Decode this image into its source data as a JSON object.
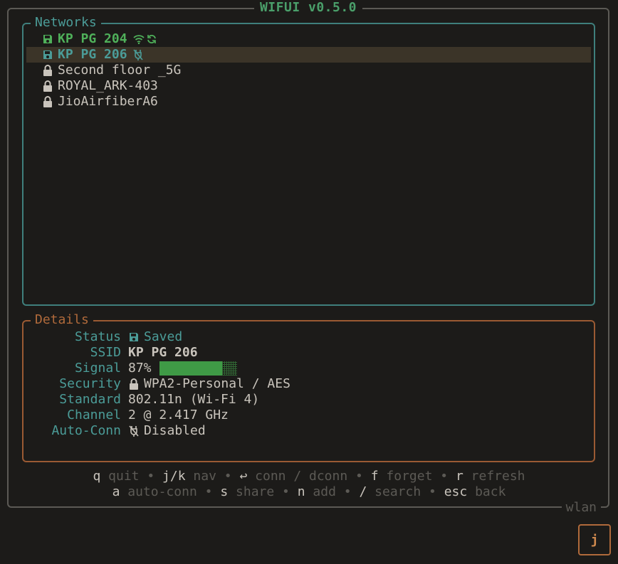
{
  "app": {
    "title": "WIFUI v0.5.0",
    "interface": "wlan"
  },
  "networks_panel": {
    "title": "Networks",
    "items": [
      {
        "name": "KP PG 204",
        "state": "connected",
        "icon": "save-icon",
        "trailing": [
          "wifi-icon",
          "refresh-icon"
        ]
      },
      {
        "name": "KP PG 206",
        "state": "saved",
        "icon": "save-icon",
        "trailing": [
          "autoconnect-off-icon"
        ],
        "selected": true
      },
      {
        "name": "Second floor _5G",
        "state": "available",
        "icon": "lock-icon",
        "trailing": []
      },
      {
        "name": "ROYAL_ARK-403",
        "state": "available",
        "icon": "lock-icon",
        "trailing": []
      },
      {
        "name": "JioAirfiberA6",
        "state": "available",
        "icon": "lock-icon",
        "trailing": []
      }
    ]
  },
  "details_panel": {
    "title": "Details",
    "status_label": "Status",
    "status_value": "Saved",
    "ssid_label": "SSID",
    "ssid_value": "KP PG 206",
    "signal_label": "Signal",
    "signal_value": "87%",
    "signal_fraction": 0.87,
    "security_label": "Security",
    "security_value": "WPA2-Personal / AES",
    "standard_label": "Standard",
    "standard_value": "802.11n (Wi-Fi 4)",
    "channel_label": "Channel",
    "channel_value": "2 @ 2.417 GHz",
    "autoconn_label": "Auto-Conn",
    "autoconn_value": "Disabled"
  },
  "help": {
    "line1": [
      {
        "key": "q",
        "desc": "quit"
      },
      {
        "key": "j/k",
        "desc": "nav"
      },
      {
        "key": "↩",
        "desc": "conn / dconn"
      },
      {
        "key": "f",
        "desc": "forget"
      },
      {
        "key": "r",
        "desc": "refresh"
      }
    ],
    "line2": [
      {
        "key": "a",
        "desc": "auto-conn"
      },
      {
        "key": "s",
        "desc": "share"
      },
      {
        "key": "n",
        "desc": "add"
      },
      {
        "key": "/",
        "desc": "search"
      },
      {
        "key": "esc",
        "desc": "back"
      }
    ],
    "separator": "•"
  },
  "key_indicator": "j",
  "colors": {
    "background": "#1c1b19",
    "connected": "#4fb05a",
    "saved": "#4b9c98",
    "networks_border": "#3f7f7c",
    "details_border": "#9a5a33",
    "title": "#4a9f6a",
    "muted": "#5c5a55",
    "selection": "#3b3428"
  }
}
